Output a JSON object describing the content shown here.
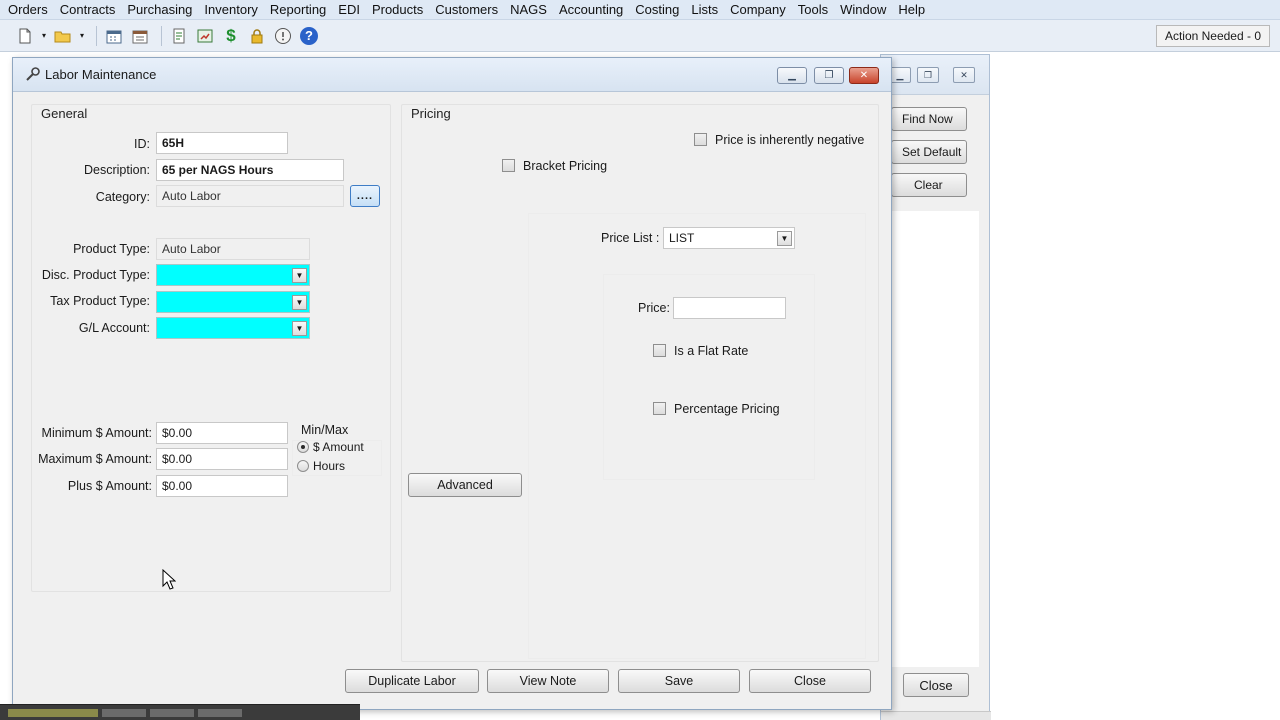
{
  "menu": [
    "Orders",
    "Contracts",
    "Purchasing",
    "Inventory",
    "Reporting",
    "EDI",
    "Products",
    "Customers",
    "NAGS",
    "Accounting",
    "Costing",
    "Lists",
    "Company",
    "Tools",
    "Window",
    "Help"
  ],
  "toolbar": {
    "icons": [
      "new-document-icon",
      "open-folder-icon",
      "calendar-icon",
      "schedule-icon",
      "report-icon",
      "export-icon",
      "dollar-icon",
      "lock-icon",
      "info-icon",
      "help-icon"
    ],
    "dollar_glyph": "$",
    "help_glyph": "?",
    "action_needed": "Action Needed - 0"
  },
  "back_window": {
    "find_now": "Find Now",
    "set_default": "Set Default",
    "clear": "Clear",
    "close": "Close"
  },
  "dialog": {
    "title": "Labor Maintenance",
    "general": {
      "group_title": "General",
      "id_label": "ID:",
      "id_value": "65H",
      "description_label": "Description:",
      "description_value": "65 per NAGS Hours",
      "category_label": "Category:",
      "category_value": "Auto Labor",
      "category_browse": "....",
      "product_type_label": "Product Type:",
      "product_type_value": "Auto Labor",
      "disc_product_type_label": "Disc. Product Type:",
      "tax_product_type_label": "Tax Product Type:",
      "gl_account_label": "G/L Account:",
      "min_amount_label": "Minimum $ Amount:",
      "min_amount_value": "$0.00",
      "max_amount_label": "Maximum $ Amount:",
      "max_amount_value": "$0.00",
      "plus_amount_label": "Plus $ Amount:",
      "plus_amount_value": "$0.00",
      "minmax_title": "Min/Max",
      "minmax_amount": "$ Amount",
      "minmax_hours": "Hours",
      "minmax_selected": "$ Amount"
    },
    "pricing": {
      "group_title": "Pricing",
      "inherently_negative": "Price is inherently negative",
      "bracket_pricing": "Bracket Pricing",
      "price_list_label": "Price List :",
      "price_list_value": "LIST",
      "price_label": "Price:",
      "price_value": "",
      "flat_rate": "Is a Flat Rate",
      "percentage_pricing": "Percentage Pricing",
      "advanced": "Advanced"
    },
    "buttons": {
      "duplicate": "Duplicate Labor",
      "view_note": "View Note",
      "save": "Save",
      "close": "Close"
    }
  }
}
